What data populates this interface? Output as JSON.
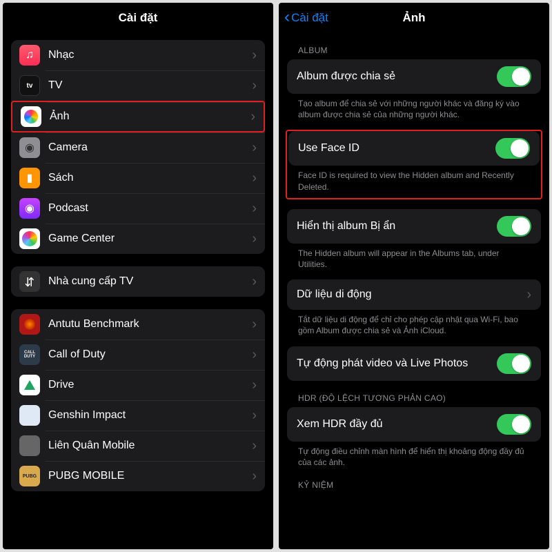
{
  "left": {
    "title": "Cài đặt",
    "groups": [
      {
        "items": [
          {
            "key": "music",
            "label": "Nhạc",
            "iconText": "♫"
          },
          {
            "key": "tv",
            "label": "TV",
            "iconText": "tv"
          },
          {
            "key": "photos",
            "label": "Ảnh",
            "highlighted": true
          },
          {
            "key": "camera",
            "label": "Camera",
            "iconText": "◉"
          },
          {
            "key": "books",
            "label": "Sách",
            "iconText": "▮"
          },
          {
            "key": "podcast",
            "label": "Podcast",
            "iconText": "◉"
          },
          {
            "key": "gamecenter",
            "label": "Game Center"
          }
        ]
      },
      {
        "items": [
          {
            "key": "tvprovider",
            "label": "Nhà cung cấp TV",
            "iconText": "⇆"
          }
        ]
      },
      {
        "items": [
          {
            "key": "antutu",
            "label": "Antutu Benchmark"
          },
          {
            "key": "cod",
            "label": "Call of Duty"
          },
          {
            "key": "drive",
            "label": "Drive"
          },
          {
            "key": "genshin",
            "label": "Genshin Impact"
          },
          {
            "key": "lq",
            "label": "Liên Quân Mobile"
          },
          {
            "key": "pubg",
            "label": "PUBG MOBILE"
          }
        ]
      }
    ]
  },
  "right": {
    "back": "Cài đặt",
    "title": "Ảnh",
    "sections": {
      "album_header": "ALBUM",
      "shared_album": {
        "label": "Album được chia sẻ",
        "note": "Tạo album để chia sẻ với những người khác và đăng ký vào album được chia sẻ của những người khác."
      },
      "faceid": {
        "label": "Use Face ID",
        "note": "Face ID is required to view the Hidden album and Recently Deleted."
      },
      "hidden_album": {
        "label": "Hiển thị album Bị ẩn",
        "note": "The Hidden album will appear in the Albums tab, under Utilities."
      },
      "cellular": {
        "label": "Dữ liệu di động",
        "note": "Tắt dữ liệu di động để chỉ cho phép cập nhật qua Wi-Fi, bao gồm Album được chia sẻ và Ảnh iCloud."
      },
      "autoplay": {
        "label": "Tự động phát video và Live Photos"
      },
      "hdr_header": "HDR (ĐỘ LỆCH TƯƠNG PHẢN CAO)",
      "hdr": {
        "label": "Xem HDR đầy đủ",
        "note": "Tự động điều chỉnh màn hình để hiển thị khoảng động đầy đủ của các ảnh."
      },
      "memories_header": "KỶ NIỆM"
    }
  }
}
